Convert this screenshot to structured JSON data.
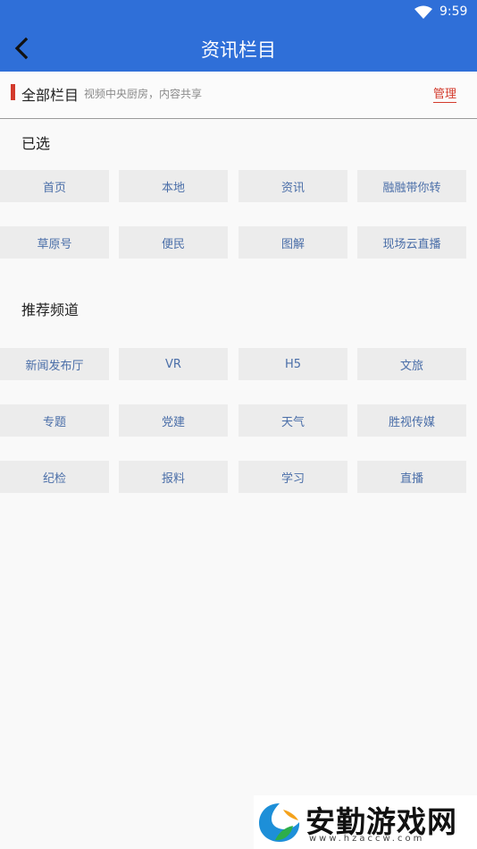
{
  "status_bar": {
    "time": "9:59",
    "icon": "wifi-signal-icon"
  },
  "app_bar": {
    "title": "资讯栏目",
    "back_icon": "chevron-left-icon"
  },
  "all_columns": {
    "label": "全部栏目",
    "subtitle": "视频中央厨房，内容共享",
    "manage_label": "管理",
    "accent_color": "#d33a2c"
  },
  "selected": {
    "title": "已选",
    "items": [
      "首页",
      "本地",
      "资讯",
      "融融带你转",
      "草原号",
      "便民",
      "图解",
      "现场云直播"
    ]
  },
  "recommended": {
    "title": "推荐频道",
    "items": [
      "新闻发布厅",
      "VR",
      "H5",
      "文旅",
      "专题",
      "党建",
      "天气",
      "胜视传媒",
      "纪检",
      "报料",
      "学习",
      "直播"
    ]
  },
  "watermark": {
    "text": "安勤游戏网",
    "url": "www.hzaccw.com"
  },
  "colors": {
    "header": "#2f6fd8",
    "chip_bg": "#ececec",
    "chip_text": "#4a6ea8"
  }
}
